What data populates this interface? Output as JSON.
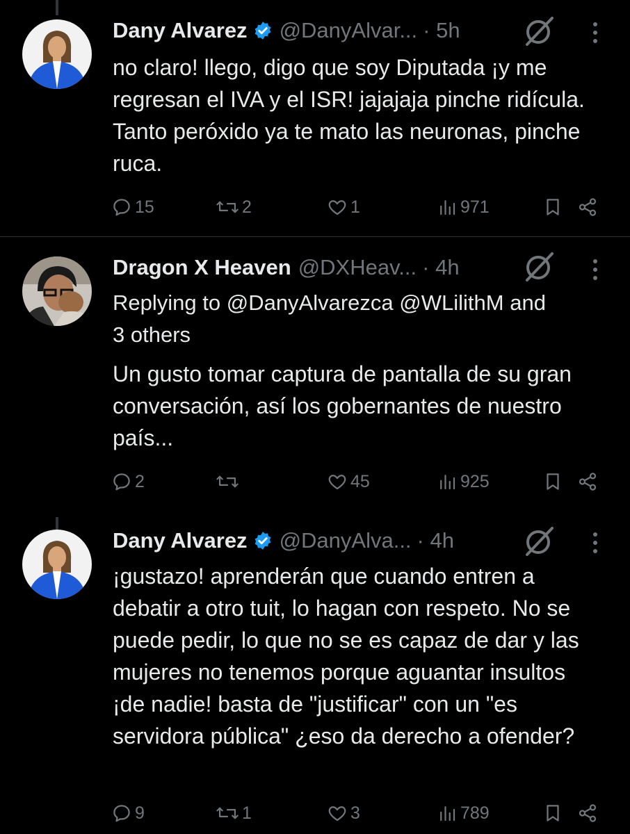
{
  "tweets": [
    {
      "name": "Dany Alvarez",
      "handle": "@DanyAlvar...",
      "time": "· 5h",
      "text": "no claro! llego, digo que soy Diputada ¡y me regresan el IVA y el ISR! jajajaja pinche ridícula. Tanto peróxido ya te mato las neuronas, pinche ruca.",
      "replies": "15",
      "reposts": "2",
      "likes": "1",
      "views": "971"
    },
    {
      "name": "Dragon X Heaven",
      "handle": "@DXHeav...",
      "time": "· 4h",
      "replying_prefix": "Replying to",
      "replying_mentions": "@DanyAlvarezca @WLilithM",
      "replying_suffix": "and",
      "replying_line2": "3 others",
      "text": "Un gusto tomar captura de pantalla de su gran conversación, así los gobernantes de nuestro país...",
      "replies": "2",
      "reposts": "",
      "likes": "45",
      "views": "925"
    },
    {
      "name": "Dany Alvarez",
      "handle": "@DanyAlva...",
      "time": "· 4h",
      "text": "¡gustazo! aprenderán que cuando entren a debatir a otro tuit, lo hagan con respeto. No se puede pedir, lo que no se es capaz de dar y las mujeres no tenemos porque aguantar insultos ¡de nadie! basta de \"justificar\" con un \"es servidora pública\" ¿eso da derecho a ofender?",
      "replies": "9",
      "reposts": "1",
      "likes": "3",
      "views": "789"
    }
  ],
  "icons": {
    "verified": "verified-badge-icon",
    "grok": "grok-icon",
    "more": "more-options-icon",
    "reply": "reply-icon",
    "repost": "repost-icon",
    "like": "like-icon",
    "views": "views-icon",
    "bookmark": "bookmark-icon",
    "share": "share-icon"
  },
  "colors": {
    "background": "#000000",
    "text": "#e7e9ea",
    "muted": "#71767b",
    "verified": "#1d9bf0"
  }
}
